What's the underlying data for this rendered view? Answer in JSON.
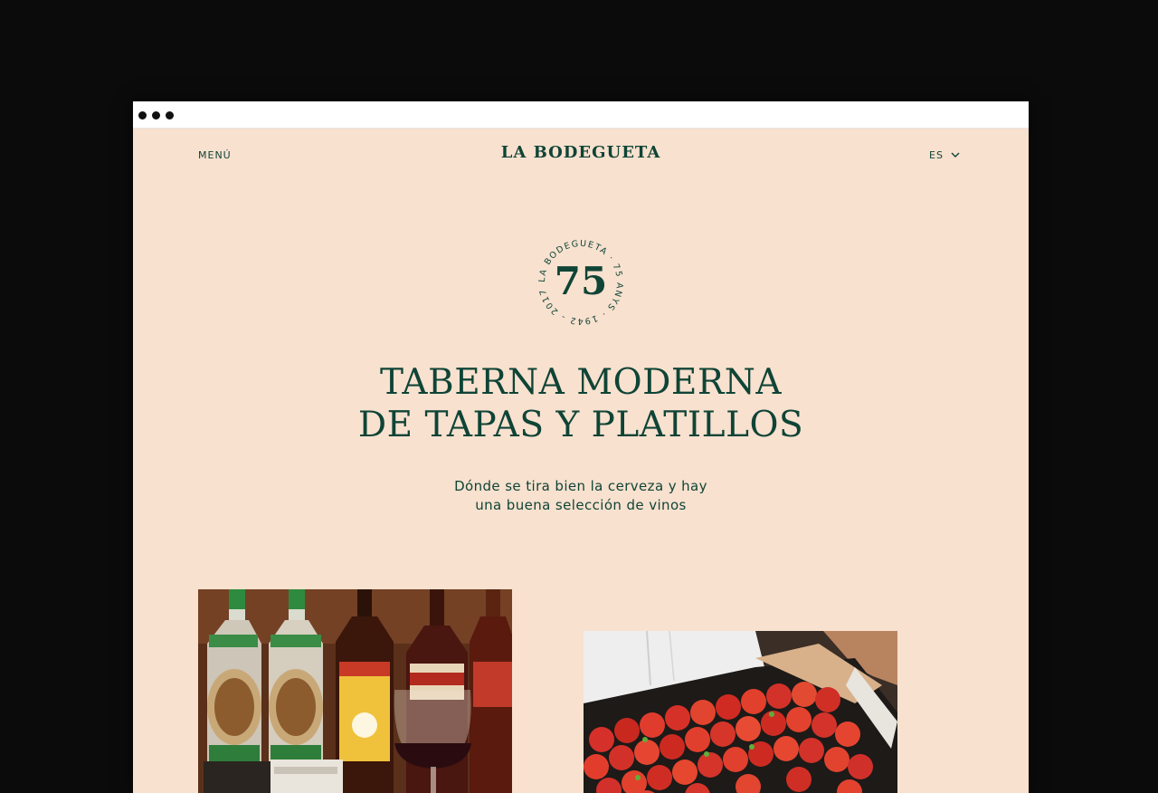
{
  "nav": {
    "menu_label": "MENÚ",
    "logo_text": "LA BODEGUETA",
    "language": "ES"
  },
  "badge": {
    "number": "75",
    "ring_text": "LA BODEGUETA · 75 ANYS · 1942 - 2017 ·"
  },
  "hero": {
    "title_line1": "TABERNA MODERNA",
    "title_line2": "DE TAPAS Y PLATILLOS",
    "subtitle_line1": "Dónde se tira bien la cerveza y hay",
    "subtitle_line2": "una buena selección de vinos"
  },
  "colors": {
    "background": "#f8e1cf",
    "accent": "#0f4436",
    "outer": "#0b0b0b"
  },
  "icons": {
    "language_dropdown": "chevron-down-icon"
  }
}
